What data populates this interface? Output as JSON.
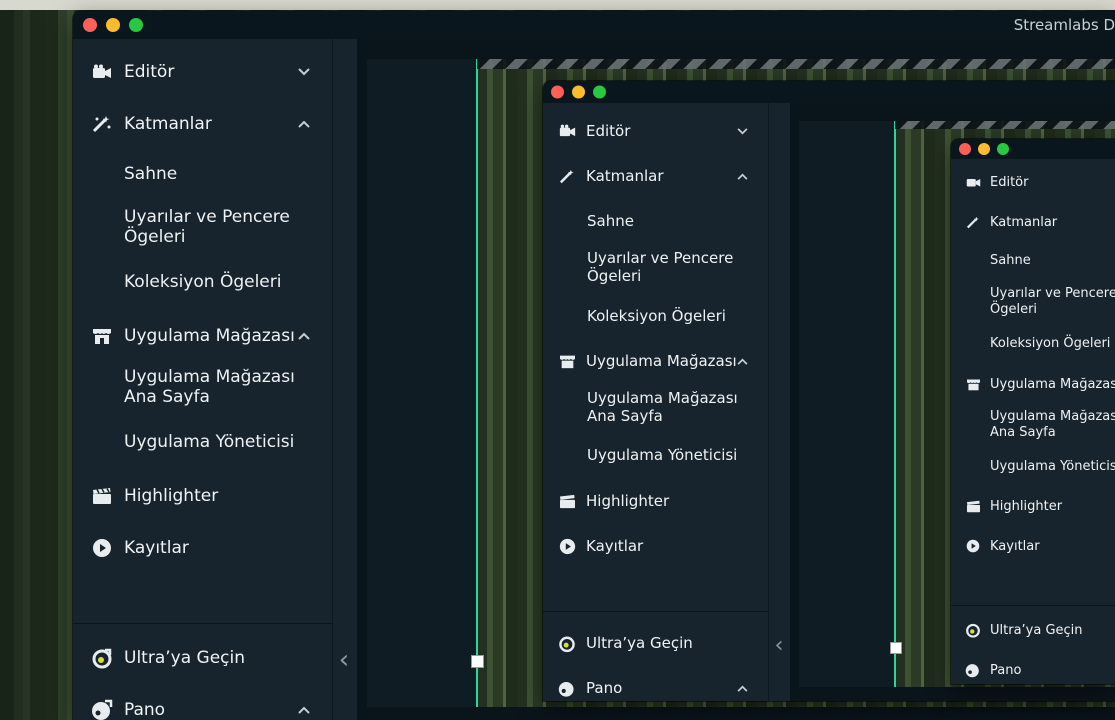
{
  "window_title": "Streamlabs D",
  "sidebar": {
    "items": [
      {
        "label": "Editör",
        "icon": "video-camera-icon",
        "chevron": "down"
      },
      {
        "label": "Katmanlar",
        "icon": "magic-wand-icon",
        "chevron": "up"
      },
      {
        "label": "Uygulama Mağazası",
        "icon": "store-icon",
        "chevron": "up"
      },
      {
        "label": "Highlighter",
        "icon": "clapperboard-icon"
      },
      {
        "label": "Kayıtlar",
        "icon": "play-circle-icon"
      }
    ],
    "katmanlar_sub": [
      "Sahne",
      "Uyarılar ve Pencere Ögeleri",
      "Koleksiyon Ögeleri"
    ],
    "store_sub": [
      "Uygulama Mağazası Ana Sayfa",
      "Uygulama Yöneticisi"
    ],
    "bottom": [
      {
        "label": "Ultra’ya Geçin",
        "icon": "ultra-icon"
      },
      {
        "label": "Pano",
        "icon": "dashboard-icon",
        "chevron": "up"
      }
    ]
  },
  "collapse_glyph": "‹",
  "colors": {
    "sidebar_bg": "#17242d",
    "titlebar_bg": "#09161d",
    "accent_green": "#30d39a",
    "traffic_red": "#fe5f57",
    "traffic_yellow": "#febb2e",
    "traffic_green": "#28c840"
  }
}
